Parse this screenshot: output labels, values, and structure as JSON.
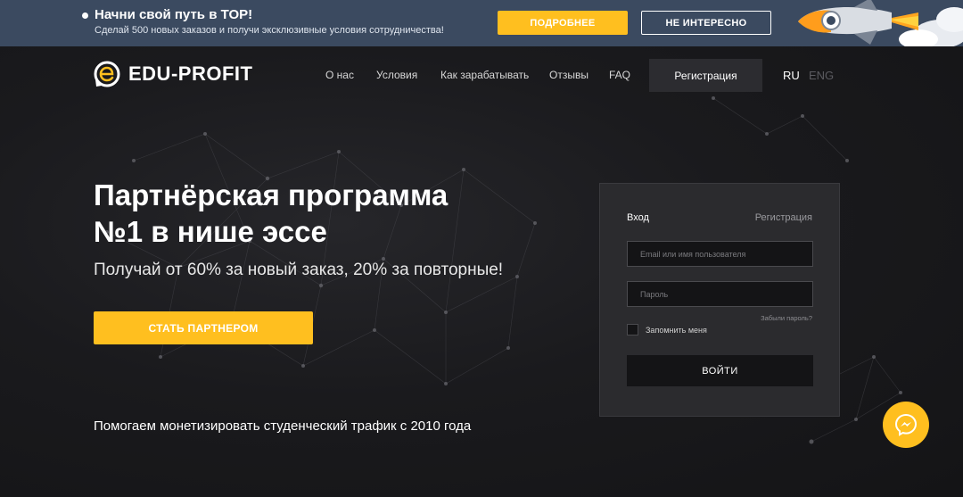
{
  "promo": {
    "title": "Начни свой путь в TOP!",
    "subtitle": "Сделай 500 новых заказов и получи эксклюзивные условия сотрудничества!",
    "more_label": "ПОДРОБНЕЕ",
    "not_interested_label": "НЕ ИНТЕРЕСНО",
    "bg_color": "#3b4a60",
    "accent": "#ffbf1f"
  },
  "header": {
    "logo_text": "EDU-PROFIT",
    "nav": [
      "О нас",
      "Условия",
      "Как зарабатывать",
      "Отзывы",
      "FAQ"
    ],
    "register_label": "Регистрация",
    "lang_ru": "RU",
    "lang_eng": "ENG"
  },
  "hero": {
    "title_line1": "Партнёрская программа",
    "title_line2": "№1 в нише эссе",
    "subtitle": "Получай от 60% за новый заказ, 20% за повторные!",
    "cta_label": "СТАТЬ ПАРТНЕРОМ",
    "footer_text": "Помогаем монетизировать студенческий трафик с 2010 года"
  },
  "login": {
    "tab_login": "Вход",
    "tab_register": "Регистрация",
    "email_placeholder": "Email или имя пользователя",
    "password_placeholder": "Пароль",
    "forgot_label": "Забыли пароль?",
    "remember_label": "Запомнить меня",
    "submit_label": "ВОЙТИ"
  },
  "chat": {
    "icon": "messenger-icon"
  }
}
